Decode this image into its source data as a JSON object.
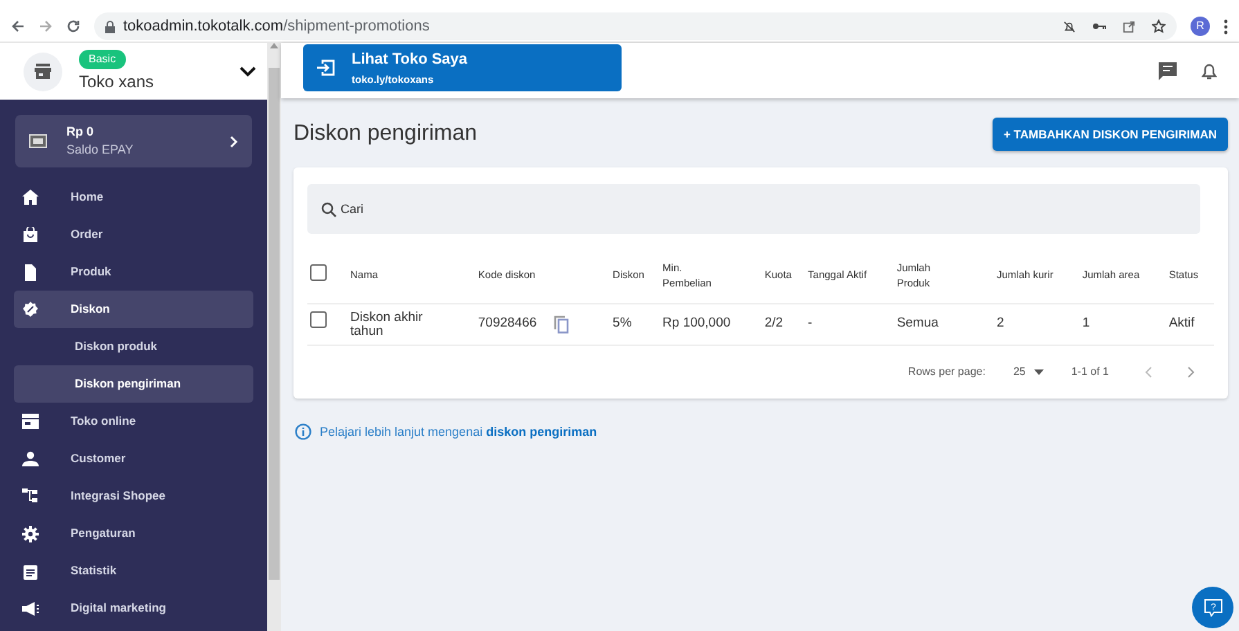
{
  "browser": {
    "url_host": "tokoadmin.tokotalk.com",
    "url_path": "/shipment-promotions",
    "avatar": "R"
  },
  "store": {
    "plan": "Basic",
    "name": "Toko xans"
  },
  "wallet": {
    "amount": "Rp 0",
    "label": "Saldo EPAY"
  },
  "sidebar": {
    "items": [
      {
        "label": "Home",
        "selected": false
      },
      {
        "label": "Order",
        "selected": false
      },
      {
        "label": "Produk",
        "selected": false
      },
      {
        "label": "Diskon",
        "selected": true,
        "children": [
          {
            "label": "Diskon produk",
            "selected": false
          },
          {
            "label": "Diskon pengiriman",
            "selected": true
          }
        ]
      },
      {
        "label": "Toko online",
        "selected": false
      },
      {
        "label": "Customer",
        "selected": false
      },
      {
        "label": "Integrasi Shopee",
        "selected": false
      },
      {
        "label": "Pengaturan",
        "selected": false
      },
      {
        "label": "Statistik",
        "selected": false
      },
      {
        "label": "Digital marketing",
        "selected": false
      }
    ]
  },
  "store_link": {
    "title": "Lihat Toko Saya",
    "url": "toko.ly/tokoxans"
  },
  "page": {
    "title": "Diskon pengiriman",
    "add_button": "+ TAMBAHKAN DISKON PENGIRIMAN"
  },
  "search": {
    "placeholder": "Cari"
  },
  "table": {
    "all_checked": false,
    "columns": [
      "Nama",
      "Kode diskon",
      "Diskon",
      "Min. Pembelian",
      "Kuota",
      "Tanggal Aktif",
      "Jumlah Produk",
      "Jumlah kurir",
      "Jumlah area",
      "Status"
    ],
    "rows": [
      {
        "checked": false,
        "cells": [
          "Diskon akhir tahun",
          "70928466",
          "5%",
          "Rp 100,000",
          "2/2",
          "-",
          "Semua",
          "2",
          "1",
          "Aktif"
        ]
      }
    ]
  },
  "pagination": {
    "rows_label": "Rows per page:",
    "rows_value": "25",
    "range": "1-1 of 1"
  },
  "info": {
    "text": "Pelajari lebih lanjut mengenai",
    "link": "diskon pengiriman"
  },
  "help": {
    "glyph": "?"
  }
}
